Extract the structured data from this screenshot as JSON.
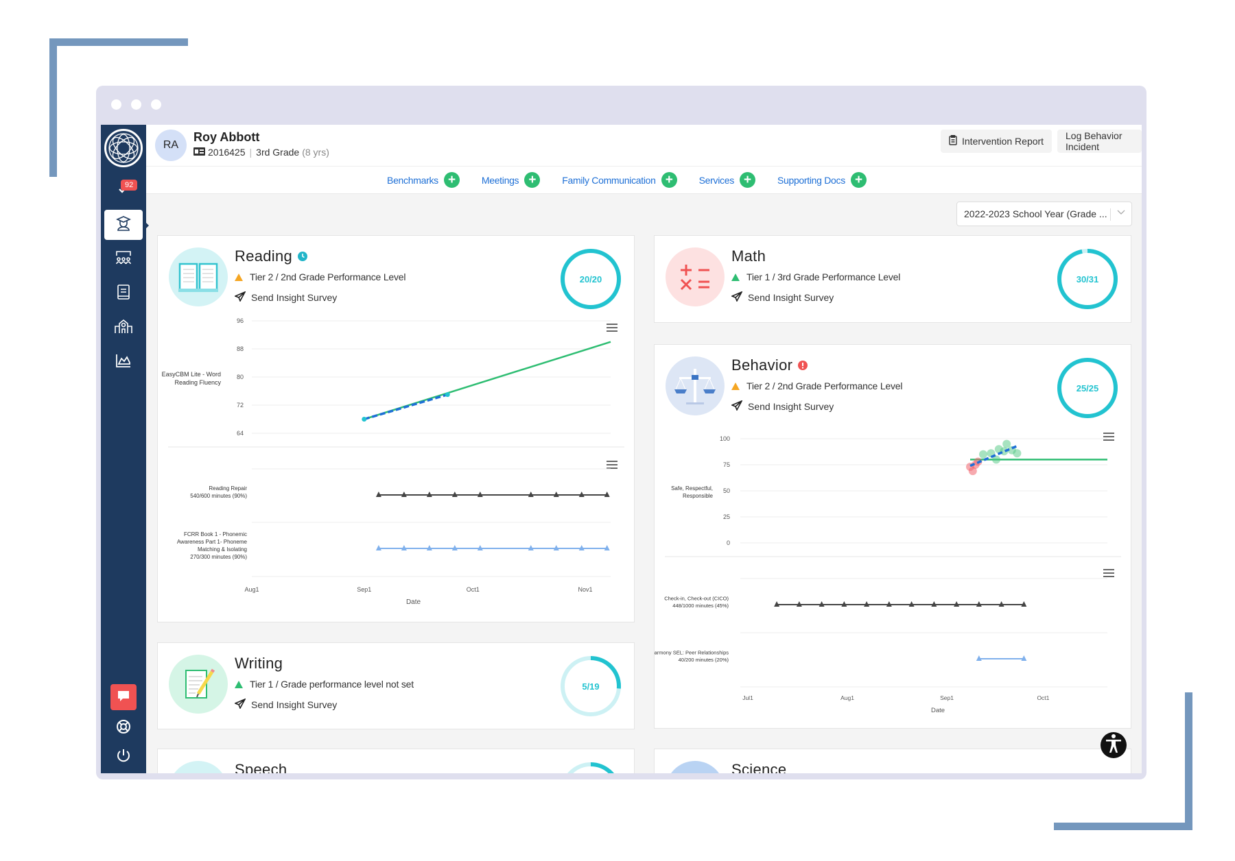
{
  "student": {
    "initials": "RA",
    "name": "Roy Abbott",
    "id": "2016425",
    "grade": "3rd Grade",
    "age": "(8 yrs)"
  },
  "sidebar": {
    "notification_count": "92",
    "items": [
      {
        "name": "tasks",
        "icon": "check-icon"
      },
      {
        "name": "students",
        "icon": "student-icon",
        "active": true
      },
      {
        "name": "groups",
        "icon": "group-icon"
      },
      {
        "name": "library",
        "icon": "book-icon"
      },
      {
        "name": "school",
        "icon": "school-icon"
      },
      {
        "name": "reports",
        "icon": "chart-icon"
      }
    ],
    "bottom": [
      {
        "name": "chat",
        "icon": "chat-icon"
      },
      {
        "name": "help",
        "icon": "lifebuoy-icon"
      },
      {
        "name": "logout",
        "icon": "power-icon"
      }
    ]
  },
  "header": {
    "intervention_report": "Intervention Report",
    "log_behavior": "Log Behavior Incident"
  },
  "tabs": [
    {
      "label": "Benchmarks"
    },
    {
      "label": "Meetings"
    },
    {
      "label": "Family Communication"
    },
    {
      "label": "Services"
    },
    {
      "label": "Supporting Docs"
    }
  ],
  "year_select": {
    "value": "2022-2023 School Year (Grade ..."
  },
  "cards": {
    "reading": {
      "title": "Reading",
      "tier": "Tier 2 / 2nd Grade Performance Level",
      "tier_level": "warning",
      "survey": "Send Insight Survey",
      "progress": {
        "done": 20,
        "total": 20,
        "label": "20/20"
      }
    },
    "math": {
      "title": "Math",
      "tier": "Tier 1 / 3rd Grade Performance Level",
      "tier_level": "good",
      "survey": "Send Insight Survey",
      "progress": {
        "done": 30,
        "total": 31,
        "label": "30/31"
      }
    },
    "behavior": {
      "title": "Behavior",
      "tier": "Tier 2 / 2nd Grade Performance Level",
      "tier_level": "warning",
      "survey": "Send Insight Survey",
      "progress": {
        "done": 25,
        "total": 25,
        "label": "25/25"
      }
    },
    "writing": {
      "title": "Writing",
      "tier": "Tier 1 / Grade performance level not set",
      "tier_level": "good",
      "survey": "Send Insight Survey",
      "progress": {
        "done": 5,
        "total": 19,
        "label": "5/19"
      }
    },
    "speech": {
      "title": "Speech",
      "progress": {
        "fraction": 0.25
      }
    },
    "science": {
      "title": "Science"
    }
  },
  "colors": {
    "sidebar": "#1e3a5f",
    "accent_blue": "#1d6fd6",
    "plus_green": "#2ebd72",
    "ring": "#22c3d0",
    "ring_track": "#cdf1f4",
    "alert_red": "#f05252",
    "warning_orange": "#f5a623",
    "bracket": "#7497bd"
  },
  "chart_data": [
    {
      "id": "reading-score",
      "type": "line",
      "ylabel": "EasyCBM Lite - Word Reading Fluency",
      "yticks": [
        64,
        72,
        80,
        88,
        96
      ],
      "ylim": [
        60,
        96
      ],
      "xlim": [
        "Aug 1",
        "Nov 8"
      ],
      "series": [
        {
          "name": "goal line",
          "color": "#2ebd72",
          "style": "solid",
          "points": [
            [
              "Sep 1",
              68
            ],
            [
              "Nov 8",
              90
            ]
          ]
        },
        {
          "name": "trend",
          "color": "#1d6fd6",
          "style": "dashed",
          "points": [
            [
              "Sep 1",
              68
            ],
            [
              "Sep 24",
              75
            ]
          ]
        },
        {
          "name": "scores",
          "color": "#22c3d0",
          "style": "markers",
          "points": [
            [
              "Sep 1",
              68
            ],
            [
              "Sep 24",
              75
            ]
          ]
        }
      ]
    },
    {
      "id": "reading-interventions",
      "type": "timeline",
      "xlabel": "Date",
      "xticks": [
        "Aug 1",
        "Sep 1",
        "Oct 1",
        "Nov 1"
      ],
      "rows": [
        {
          "label_line1": "Reading Repair",
          "label_line2": "540/600 minutes (90%)",
          "color": "#444444",
          "dates": [
            "Sep 5",
            "Sep 12",
            "Sep 19",
            "Sep 26",
            "Oct 3",
            "Oct 17",
            "Oct 24",
            "Oct 31",
            "Nov 7"
          ]
        },
        {
          "label_line1": "FCRR Book 1 - Phonemic",
          "label_line2": "Awareness Part 1- Phoneme",
          "label_line3": "Matching & Isolating",
          "label_line4": "270/300 minutes (90%)",
          "color": "#7fb0ec",
          "dates": [
            "Sep 5",
            "Sep 12",
            "Sep 19",
            "Sep 26",
            "Oct 3",
            "Oct 17",
            "Oct 24",
            "Oct 31",
            "Nov 7"
          ]
        }
      ]
    },
    {
      "id": "behavior-score",
      "type": "scatter",
      "ylabel": "Safe, Respectful, Responsible",
      "yticks": [
        0,
        25,
        50,
        75,
        100
      ],
      "ylim": [
        0,
        100
      ],
      "goal": 80,
      "points": [
        {
          "x": 0.0,
          "y": 73,
          "color": "red"
        },
        {
          "x": 0.01,
          "y": 69,
          "color": "red"
        },
        {
          "x": 0.02,
          "y": 75,
          "color": "red"
        },
        {
          "x": 0.03,
          "y": 78,
          "color": "red"
        },
        {
          "x": 0.05,
          "y": 85,
          "color": "green"
        },
        {
          "x": 0.08,
          "y": 86,
          "color": "green"
        },
        {
          "x": 0.1,
          "y": 80,
          "color": "green"
        },
        {
          "x": 0.11,
          "y": 90,
          "color": "green"
        },
        {
          "x": 0.13,
          "y": 88,
          "color": "green"
        },
        {
          "x": 0.14,
          "y": 95,
          "color": "green"
        },
        {
          "x": 0.16,
          "y": 89,
          "color": "green"
        },
        {
          "x": 0.18,
          "y": 86,
          "color": "green"
        }
      ],
      "trend": [
        [
          0.0,
          74
        ],
        [
          0.18,
          93
        ]
      ]
    },
    {
      "id": "behavior-interventions",
      "type": "timeline",
      "xlabel": "Date",
      "xticks": [
        "Jul 1",
        "Aug 1",
        "Sep 1",
        "Oct 1"
      ],
      "rows": [
        {
          "label_line1": "Check-in, Check-out (CICO)",
          "label_line2": "448/1000 minutes (45%)",
          "color": "#444444",
          "dates": [
            "Jul 10",
            "Jul 17",
            "Jul 24",
            "Jul 31",
            "Aug 7",
            "Aug 14",
            "Aug 21",
            "Aug 28",
            "Sep 4",
            "Sep 11",
            "Sep 18",
            "Sep 25"
          ]
        },
        {
          "label_line1": "Harmony SEL: Peer Relationships",
          "label_line2": "40/200 minutes (20%)",
          "color": "#7fb0ec",
          "dates": [
            "Sep 11",
            "Sep 25"
          ]
        }
      ]
    }
  ]
}
